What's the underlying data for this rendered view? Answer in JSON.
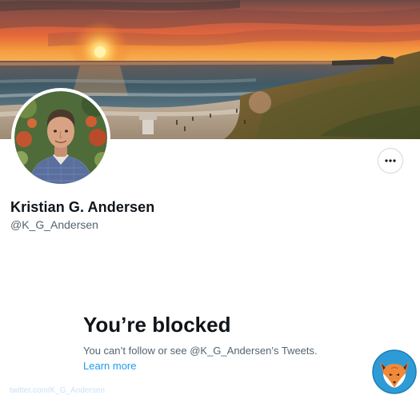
{
  "profile": {
    "display_name": "Kristian G. Andersen",
    "handle": "@K_G_Andersen"
  },
  "header": {
    "banner_icon": "sunset-beach-banner",
    "avatar_icon": "profile-photo",
    "more_icon": "more-horizontal-icon"
  },
  "blocked": {
    "heading": "You’re blocked",
    "message": "You can’t follow or see @K_G_Andersen’s Tweets.",
    "learn_more": "Learn more"
  },
  "watermark": {
    "text": "twitter.com/K_G_Andersen",
    "logo_icon": "fox-logo"
  },
  "colors": {
    "text_primary": "#0f1419",
    "text_secondary": "#536471",
    "link": "#1d9bf0",
    "border": "#cfd9de"
  }
}
